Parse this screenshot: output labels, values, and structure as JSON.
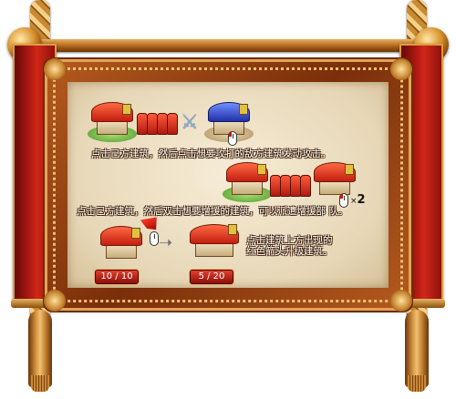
{
  "instructions": {
    "attack": "点击己方建筑，然后点击想要攻打的敌方建筑发动攻击。",
    "reinforce": "点击己方建筑，然后双击想要增援的建筑，可以派遣增援部 队。",
    "upgrade": "点击建筑上方出现的红色箭头升级建筑。"
  },
  "multiplier": {
    "symbol": "×",
    "count": "2"
  },
  "building_levels": {
    "before": "10 / 10",
    "after": "5 / 20"
  },
  "icons": {
    "own_building": "red-roof-building-icon",
    "enemy_building": "blue-roof-building-icon",
    "troops": "soldier-troops-icon",
    "attack": "crossed-swords-icon",
    "mouse": "mouse-click-icon",
    "upgrade": "red-arrow-icon",
    "transition": "right-arrow-icon"
  },
  "colors": {
    "parchment": "#efe3c8",
    "frame": "#8a3a10",
    "banner": "#b21a12",
    "text_outline": "#3a1a04",
    "pill": "#b81c10"
  }
}
